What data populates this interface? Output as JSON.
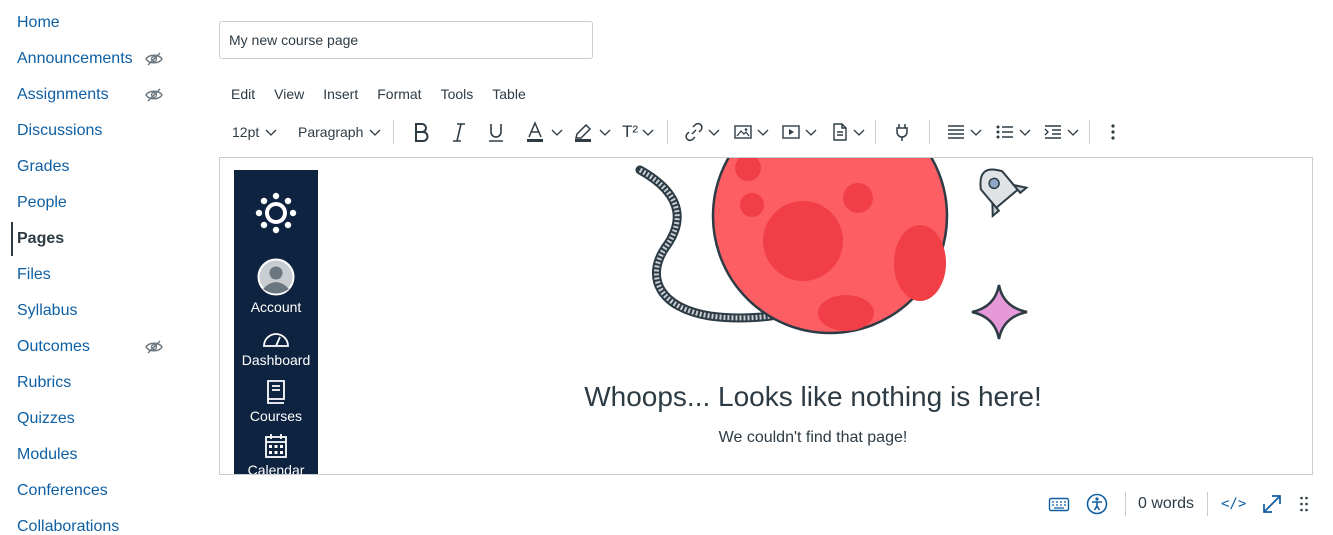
{
  "course_nav": {
    "items": [
      {
        "label": "Home",
        "hidden": false,
        "active": false
      },
      {
        "label": "Announcements",
        "hidden": true,
        "active": false
      },
      {
        "label": "Assignments",
        "hidden": true,
        "active": false
      },
      {
        "label": "Discussions",
        "hidden": false,
        "active": false
      },
      {
        "label": "Grades",
        "hidden": false,
        "active": false
      },
      {
        "label": "People",
        "hidden": false,
        "active": false
      },
      {
        "label": "Pages",
        "hidden": false,
        "active": true
      },
      {
        "label": "Files",
        "hidden": false,
        "active": false
      },
      {
        "label": "Syllabus",
        "hidden": false,
        "active": false
      },
      {
        "label": "Outcomes",
        "hidden": true,
        "active": false
      },
      {
        "label": "Rubrics",
        "hidden": false,
        "active": false
      },
      {
        "label": "Quizzes",
        "hidden": false,
        "active": false
      },
      {
        "label": "Modules",
        "hidden": false,
        "active": false
      },
      {
        "label": "Conferences",
        "hidden": false,
        "active": false
      },
      {
        "label": "Collaborations",
        "hidden": false,
        "active": false
      }
    ]
  },
  "page_title": {
    "value": "My new course page"
  },
  "menubar": [
    "Edit",
    "View",
    "Insert",
    "Format",
    "Tools",
    "Table"
  ],
  "toolbar": {
    "font_size": "12pt",
    "block_format": "Paragraph",
    "icons": [
      "bold-icon",
      "italic-icon",
      "underline-icon",
      "text-color-icon",
      "highlight-color-icon",
      "superscript-icon",
      "link-icon",
      "image-icon",
      "media-icon",
      "document-icon",
      "lti-apps-icon",
      "align-icon",
      "list-icon",
      "indent-icon",
      "more-icon"
    ],
    "superscript_label": "T²"
  },
  "editor": {
    "global_nav": {
      "items": [
        {
          "label": "Account",
          "icon": "user-avatar-icon"
        },
        {
          "label": "Dashboard",
          "icon": "dashboard-icon"
        },
        {
          "label": "Courses",
          "icon": "courses-icon"
        },
        {
          "label": "Calendar",
          "icon": "calendar-icon"
        }
      ]
    },
    "error_title": "Whoops... Looks like nothing is here!",
    "error_subtitle": "We couldn't find that page!"
  },
  "statusbar": {
    "word_count": "0 words",
    "html_toggle": "</>",
    "icons": [
      "keyboard-shortcuts-icon",
      "accessibility-checker-icon",
      "fullscreen-icon",
      "resize-handle-icon"
    ]
  },
  "colors": {
    "link": "#0e5fa3",
    "text": "#2d3b45",
    "global_nav_bg": "#0e2340",
    "planet": "#fc5e64",
    "star": "#e699d8"
  }
}
